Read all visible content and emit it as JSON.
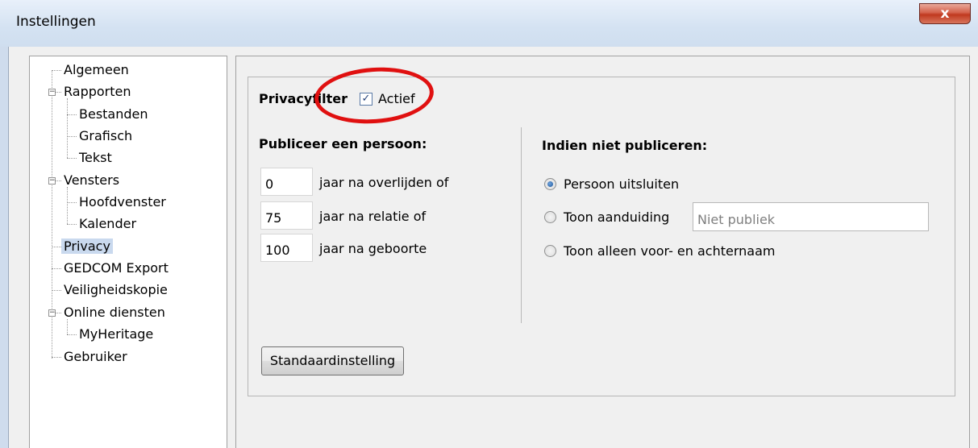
{
  "window": {
    "title": "Instellingen",
    "close_label": "x"
  },
  "tree": {
    "items": [
      {
        "label": "Algemeen"
      },
      {
        "label": "Rapporten"
      },
      {
        "label": "Bestanden"
      },
      {
        "label": "Grafisch"
      },
      {
        "label": "Tekst"
      },
      {
        "label": "Vensters"
      },
      {
        "label": "Hoofdvenster"
      },
      {
        "label": "Kalender"
      },
      {
        "label": "Privacy",
        "selected": true
      },
      {
        "label": "GEDCOM Export"
      },
      {
        "label": "Veiligheidskopie"
      },
      {
        "label": "Online diensten"
      },
      {
        "label": "MyHeritage"
      },
      {
        "label": "Gebruiker"
      }
    ]
  },
  "privacy": {
    "filter_label": "Privacyfilter",
    "active_label": "Actief",
    "active_checked": true,
    "publish_heading": "Publiceer een persoon:",
    "rows": [
      {
        "value": "0",
        "label": "jaar na overlijden of"
      },
      {
        "value": "75",
        "label": "jaar na relatie of"
      },
      {
        "value": "100",
        "label": "jaar na geboorte"
      }
    ],
    "not_publish_heading": "Indien niet publiceren:",
    "options": [
      {
        "label": "Persoon uitsluiten",
        "checked": true
      },
      {
        "label": "Toon aanduiding",
        "checked": false
      },
      {
        "label": "Toon alleen voor- en achternaam",
        "checked": false
      }
    ],
    "designation_value": "Niet publiek",
    "default_button": "Standaardinstelling"
  },
  "colors": {
    "highlight_ring": "#e01010",
    "selection": "#c9d9ee"
  }
}
